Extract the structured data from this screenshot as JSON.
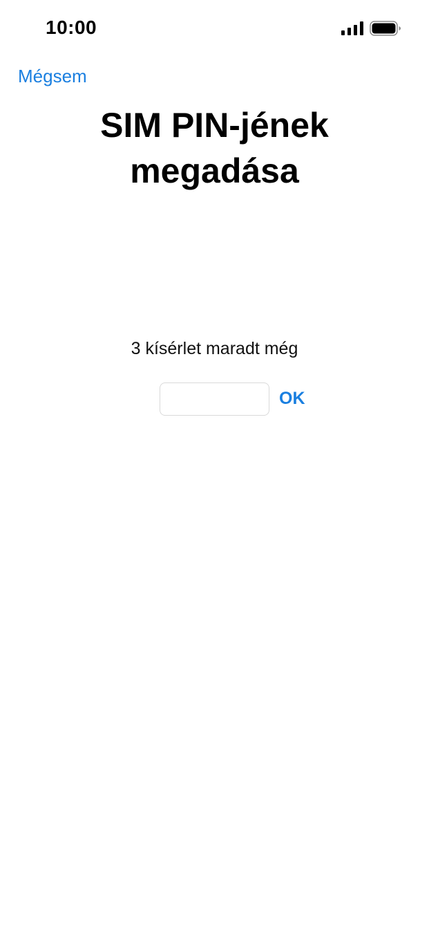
{
  "status_bar": {
    "time": "10:00",
    "signal_icon": "cellular-signal-icon",
    "battery_icon": "battery-icon"
  },
  "nav": {
    "cancel_label": "Mégsem"
  },
  "title": "SIM PIN-jének megadása",
  "attempts_text": "3 kísérlet maradt még",
  "pin_input": {
    "value": "",
    "placeholder": ""
  },
  "ok_label": "OK",
  "colors": {
    "accent": "#1a7fe0",
    "text": "#000000",
    "background": "#ffffff"
  }
}
